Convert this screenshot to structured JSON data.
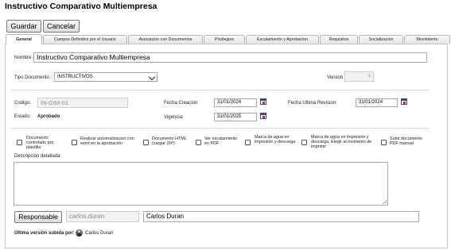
{
  "page": {
    "title": "Instructivo Comparativo Multiempresa"
  },
  "toolbar": {
    "save_label": "Guardar",
    "cancel_label": "Cancelar"
  },
  "tabs": [
    {
      "label": "General",
      "active": true
    },
    {
      "label": "Campos Definidos por el Usuario",
      "active": false
    },
    {
      "label": "Asociacion con Documentos",
      "active": false
    },
    {
      "label": "Privilegios",
      "active": false
    },
    {
      "label": "Escalamiento y Aprobacion",
      "active": false
    },
    {
      "label": "Requisitos",
      "active": false
    },
    {
      "label": "Socialización",
      "active": false
    },
    {
      "label": "Movimiento",
      "active": false
    }
  ],
  "form": {
    "nombre": {
      "label": "Nombre:",
      "value": "Instructivo Comparativo Multiempresa"
    },
    "tipo_documento": {
      "label": "Tipo Documento",
      "value": "INSTRUCTIVOS"
    },
    "version": {
      "label": "Version",
      "value": "1"
    },
    "codigo": {
      "label": "Codigo:",
      "value": "IN-GIM-01"
    },
    "fecha_creacion": {
      "label": "Fecha Creacion:",
      "value": "31/01/2024"
    },
    "fecha_ultima_revision": {
      "label": "Fecha Ultima Revision",
      "value": "31/01/2024"
    },
    "estado": {
      "label": "Estado:",
      "value": "Aprobado"
    },
    "vigencia": {
      "label": "Vigencia:",
      "value": "31/01/2025"
    },
    "options": [
      {
        "label": "Documento controlado por plantilla",
        "checked": false
      },
      {
        "label": "Realizar automatizacion con word en la aprobación",
        "checked": false
      },
      {
        "label": "Documento HTML (cargar ZIP)",
        "checked": false
      },
      {
        "label": "Ver escalamiento en PDF",
        "checked": false
      },
      {
        "label": "Marca de agua en impresión y descarga",
        "checked": false
      },
      {
        "label": "Marca de agua en impresión y descarga. Elegir al momento de imprimir",
        "checked": false
      },
      {
        "label": "Subir documento PDF manual",
        "checked": false
      }
    ],
    "descripcion": {
      "label": "Descripción detallada:",
      "value": ""
    },
    "responsable": {
      "button_label": "Responsable",
      "user": "carlos.duran",
      "name": "Carlos Duran"
    },
    "ultima_version": {
      "label": "Ultima versión subida por:",
      "user_name": "Carlos Duran"
    }
  }
}
